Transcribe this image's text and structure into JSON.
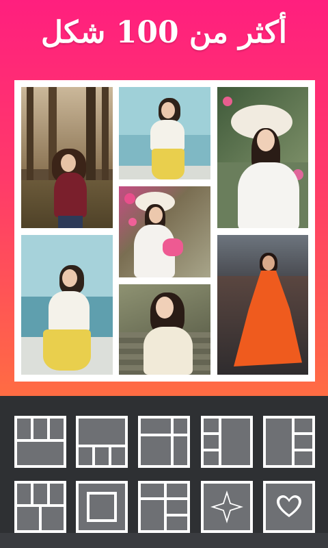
{
  "header": {
    "title": "أكثر من 100 شكل"
  },
  "colors": {
    "gradient_top": "#ff1f7e",
    "gradient_bottom": "#ff6c43",
    "panel": "#2e3033",
    "cell": "#6e7074"
  },
  "collage": {
    "photos": [
      "forest-portrait",
      "seaside-portrait",
      "sun-hat-portrait",
      "flower-hat-portrait",
      "seaside-portrait-wide",
      "sitting-portrait",
      "red-coat-portrait"
    ]
  },
  "layouts": [
    "three-top-one-bottom",
    "one-top-three-bottom",
    "grid-mixed",
    "side-columns-center",
    "left-big-right-stack",
    "two-top-two-bottom",
    "center-square",
    "stacked-rows",
    "diamond-star",
    "heart"
  ]
}
